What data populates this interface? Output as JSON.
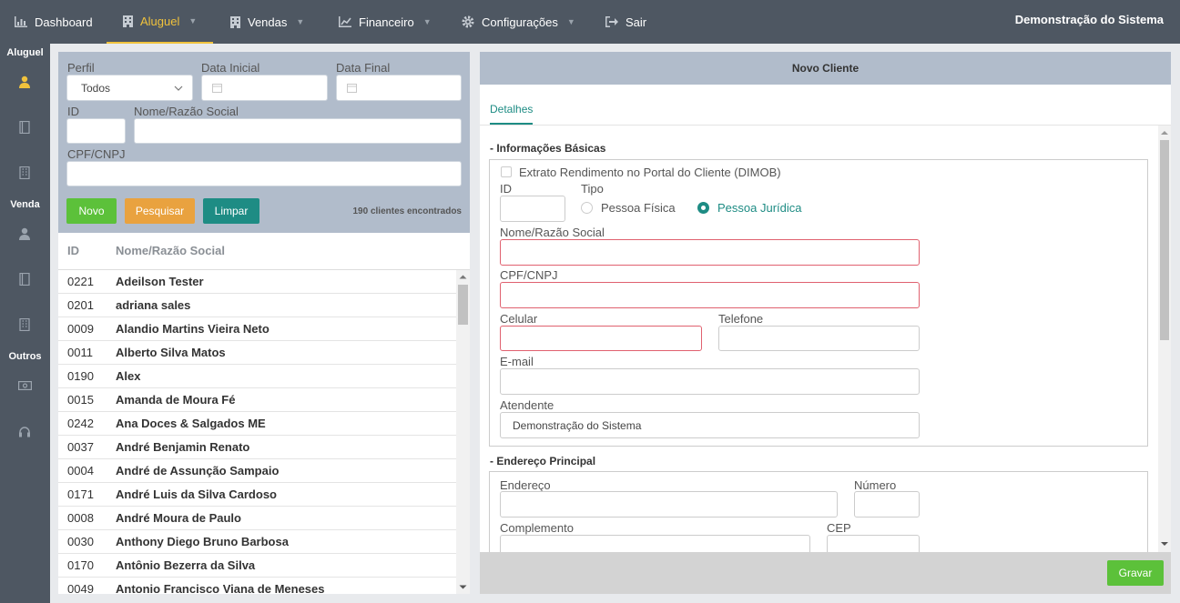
{
  "topbar": {
    "items": [
      {
        "label": "Dashboard",
        "icon": "chart-bar-icon"
      },
      {
        "label": "Aluguel",
        "icon": "building-icon",
        "active": true,
        "dropdown": true
      },
      {
        "label": "Vendas",
        "icon": "building-icon",
        "dropdown": true
      },
      {
        "label": "Financeiro",
        "icon": "line-chart-icon",
        "dropdown": true
      },
      {
        "label": "Configurações",
        "icon": "gear-icon",
        "dropdown": true
      },
      {
        "label": "Sair",
        "icon": "sign-out-icon"
      }
    ],
    "system_name": "Demonstração do Sistema"
  },
  "sidebar": {
    "sections": [
      "Aluguel",
      "Venda",
      "Outros"
    ],
    "icons": [
      "user-icon",
      "book-icon",
      "building-icon",
      "user-icon",
      "book-icon",
      "building-icon",
      "money-icon",
      "headset-icon"
    ]
  },
  "filter": {
    "perfil_label": "Perfil",
    "perfil_value": "Todos",
    "data_inicial_label": "Data Inicial",
    "data_final_label": "Data Final",
    "id_label": "ID",
    "nome_label": "Nome/Razão Social",
    "cpf_label": "CPF/CNPJ",
    "btn_novo": "Novo",
    "btn_pesquisar": "Pesquisar",
    "btn_limpar": "Limpar",
    "count": "190 clientes encontrados"
  },
  "list": {
    "col_id": "ID",
    "col_nome": "Nome/Razão Social",
    "rows": [
      {
        "id": "0221",
        "nome": "Adeilson Tester"
      },
      {
        "id": "0201",
        "nome": "adriana sales"
      },
      {
        "id": "0009",
        "nome": "Alandio Martins Vieira Neto"
      },
      {
        "id": "0011",
        "nome": "Alberto Silva Matos"
      },
      {
        "id": "0190",
        "nome": "Alex"
      },
      {
        "id": "0015",
        "nome": "Amanda de Moura Fé"
      },
      {
        "id": "0242",
        "nome": "Ana Doces & Salgados ME"
      },
      {
        "id": "0037",
        "nome": "André Benjamin Renato"
      },
      {
        "id": "0004",
        "nome": "André de Assunção Sampaio"
      },
      {
        "id": "0171",
        "nome": "André Luis da Silva Cardoso"
      },
      {
        "id": "0008",
        "nome": "André Moura de Paulo"
      },
      {
        "id": "0030",
        "nome": "Anthony Diego Bruno Barbosa"
      },
      {
        "id": "0170",
        "nome": "Antônio Bezerra da Silva"
      },
      {
        "id": "0049",
        "nome": "Antonio Francisco Viana de Meneses"
      }
    ]
  },
  "novo_cliente": {
    "title": "Novo Cliente",
    "tab": "Detalhes",
    "sec_basicas": "- Informações Básicas",
    "dimob_label": "Extrato Rendimento no Portal do Cliente (DIMOB)",
    "id_label": "ID",
    "tipo_label": "Tipo",
    "tipo_fisica": "Pessoa Física",
    "tipo_juridica": "Pessoa Jurídica",
    "tipo_selected": "Pessoa Jurídica",
    "nome_label": "Nome/Razão Social",
    "cpf_label": "CPF/CNPJ",
    "celular_label": "Celular",
    "telefone_label": "Telefone",
    "email_label": "E-mail",
    "atendente_label": "Atendente",
    "atendente_value": "Demonstração do Sistema",
    "sec_endereco": "- Endereço Principal",
    "endereco_label": "Endereço",
    "numero_label": "Número",
    "complemento_label": "Complemento",
    "cep_label": "CEP",
    "btn_gravar": "Gravar"
  },
  "colors": {
    "topbar": "#4e5762",
    "active": "#f0c23c",
    "panel_header": "#b1bccb",
    "green": "#5cc13a",
    "orange": "#e9a23f",
    "teal": "#1e8c84",
    "required": "#e0616f"
  }
}
